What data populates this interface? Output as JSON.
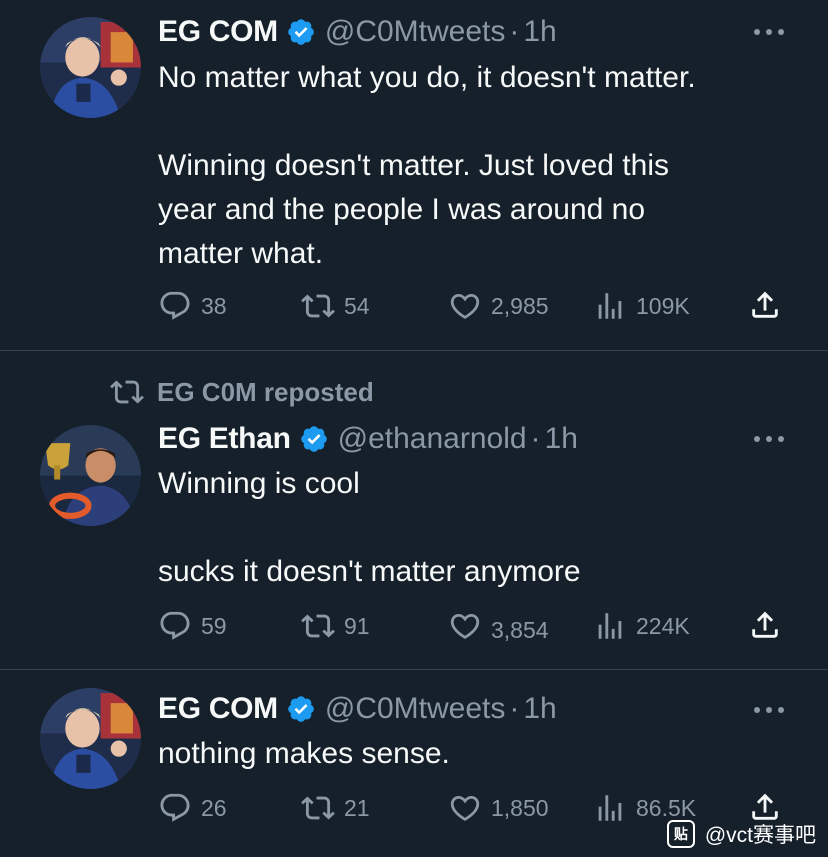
{
  "tweets": [
    {
      "name": "EG COM",
      "handle": "@C0Mtweets",
      "separator": "·",
      "time": "1h",
      "lines": [
        "No matter what you do, it doesn't matter.",
        "",
        "Winning doesn't matter. Just loved this",
        "year and the people I was around no",
        "matter what."
      ],
      "replies": "38",
      "reposts": "54",
      "likes": "2,985",
      "views": "109K",
      "icons": {
        "reply": "reply-icon",
        "repost": "repost-icon",
        "like": "heart-icon",
        "views": "analytics-icon",
        "share": "share-icon",
        "verified": "verified-badge-icon",
        "more": "more-options-icon"
      }
    },
    {
      "repost_label": "EG C0M reposted",
      "name": "EG Ethan",
      "handle": "@ethanarnold",
      "separator": "·",
      "time": "1h",
      "lines": [
        "Winning is cool",
        "",
        "sucks it doesn't matter anymore"
      ],
      "replies": "59",
      "reposts": "91",
      "likes": "3,854",
      "views": "224K"
    },
    {
      "name": "EG COM",
      "handle": "@C0Mtweets",
      "separator": "·",
      "time": "1h",
      "lines": [
        "nothing makes sense."
      ],
      "replies": "26",
      "reposts": "21",
      "likes": "1,850",
      "views": "86.5K"
    }
  ],
  "watermark": {
    "logo": "贴",
    "text": "@vct赛事吧"
  },
  "colors": {
    "background": "#15202b",
    "text": "#f7f9f9",
    "muted": "#8b98a5",
    "verified": "#1d9bf0",
    "divider": "#38444d"
  }
}
